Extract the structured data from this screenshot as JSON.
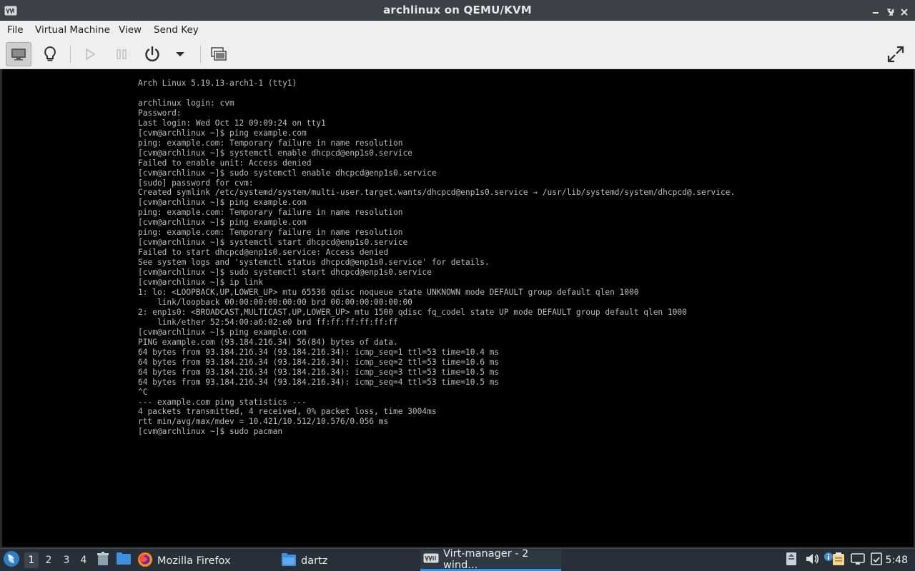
{
  "window": {
    "title": "archlinux on QEMU/KVM",
    "icon": "virt-manager-icon"
  },
  "menubar": {
    "items": [
      "File",
      "Virtual Machine",
      "View",
      "Send Key"
    ]
  },
  "toolbar": {
    "buttons": [
      {
        "icon": "console-monitor-icon",
        "active": true
      },
      {
        "icon": "lightbulb-details-icon",
        "active": false
      },
      {
        "icon": "play-run-icon",
        "disabled": true
      },
      {
        "icon": "pause-icon",
        "disabled": true
      },
      {
        "icon": "power-icon",
        "active": false
      },
      {
        "icon": "dropdown-arrow-icon",
        "active": false
      },
      {
        "icon": "snapshots-icon",
        "active": false
      },
      {
        "icon": "fullscreen-icon",
        "active": false
      }
    ]
  },
  "console": {
    "lines": [
      "Arch Linux 5.19.13-arch1-1 (tty1)",
      "",
      "archlinux login: cvm",
      "Password:",
      "Last login: Wed Oct 12 09:09:24 on tty1",
      "[cvm@archlinux ~]$ ping example.com",
      "ping: example.com: Temporary failure in name resolution",
      "[cvm@archlinux ~]$ systemctl enable dhcpcd@enp1s0.service",
      "Failed to enable unit: Access denied",
      "[cvm@archlinux ~]$ sudo systemctl enable dhcpcd@enp1s0.service",
      "[sudo] password for cvm:",
      "Created symlink /etc/systemd/system/multi-user.target.wants/dhcpcd@enp1s0.service → /usr/lib/systemd/system/dhcpcd@.service.",
      "[cvm@archlinux ~]$ ping example.com",
      "ping: example.com: Temporary failure in name resolution",
      "[cvm@archlinux ~]$ ping example.com",
      "ping: example.com: Temporary failure in name resolution",
      "[cvm@archlinux ~]$ systemctl start dhcpcd@enp1s0.service",
      "Failed to start dhcpcd@enp1s0.service: Access denied",
      "See system logs and 'systemctl status dhcpcd@enp1s0.service' for details.",
      "[cvm@archlinux ~]$ sudo systemctl start dhcpcd@enp1s0.service",
      "[cvm@archlinux ~]$ ip link",
      "1: lo: <LOOPBACK,UP,LOWER_UP> mtu 65536 qdisc noqueue state UNKNOWN mode DEFAULT group default qlen 1000",
      "    link/loopback 00:00:00:00:00:00 brd 00:00:00:00:00:00",
      "2: enp1s0: <BROADCAST,MULTICAST,UP,LOWER_UP> mtu 1500 qdisc fq_codel state UP mode DEFAULT group default qlen 1000",
      "    link/ether 52:54:00:a6:02:e0 brd ff:ff:ff:ff:ff:ff",
      "[cvm@archlinux ~]$ ping example.com",
      "PING example.com (93.184.216.34) 56(84) bytes of data.",
      "64 bytes from 93.184.216.34 (93.184.216.34): icmp_seq=1 ttl=53 time=10.4 ms",
      "64 bytes from 93.184.216.34 (93.184.216.34): icmp_seq=2 ttl=53 time=10.6 ms",
      "64 bytes from 93.184.216.34 (93.184.216.34): icmp_seq=3 ttl=53 time=10.5 ms",
      "64 bytes from 93.184.216.34 (93.184.216.34): icmp_seq=4 ttl=53 time=10.5 ms",
      "^C",
      "--- example.com ping statistics ---",
      "4 packets transmitted, 4 received, 0% packet loss, time 3004ms",
      "rtt min/avg/max/mdev = 10.421/10.512/10.576/0.056 ms",
      "[cvm@archlinux ~]$ sudo pacman"
    ]
  },
  "taskbar": {
    "workspaces": [
      "1",
      "2",
      "3",
      "4"
    ],
    "current_workspace": "1",
    "tasks": [
      {
        "label": "Mozilla Firefox",
        "icon": "firefox-icon"
      },
      {
        "label": "dartz",
        "icon": "folder-icon"
      },
      {
        "label": "Virt-manager - 2 wind...",
        "icon": "virt-manager-icon",
        "active": true
      }
    ],
    "tray_icons": [
      "removable-drive-icon",
      "volume-icon",
      "info-notification-icon",
      "clipboard-icon",
      "network-icon",
      "updates-icon"
    ],
    "clock": "5:48"
  },
  "colors": {
    "titlebar_bg": "#3c4047",
    "menubar_bg": "#efefef",
    "console_bg": "#000000",
    "console_fg": "#bcbcbc",
    "taskbar_bg": "#273038",
    "accent": "#3c8fd8"
  }
}
